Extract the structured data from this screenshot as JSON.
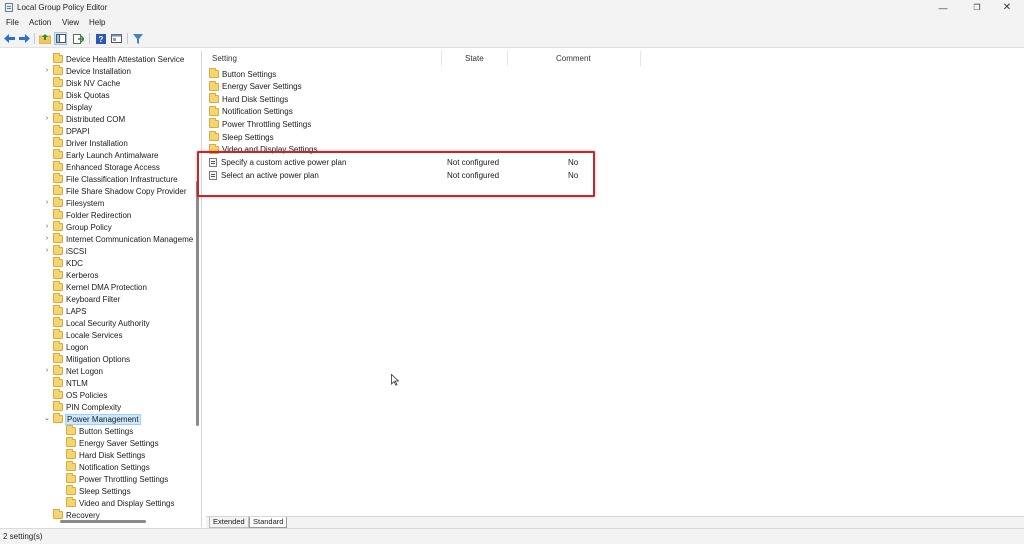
{
  "window": {
    "title": "Local Group Policy Editor",
    "min_glyph": "—",
    "max_glyph": "❐",
    "close_glyph": "✕"
  },
  "menu": {
    "file": "File",
    "action": "Action",
    "view": "View",
    "help": "Help"
  },
  "toolbar": {
    "icons": [
      "back-arrow-icon",
      "forward-arrow-icon",
      "up-folder-icon",
      "show-hide-tree-icon",
      "export-list-icon",
      "help-icon",
      "properties-icon",
      "filter-icon"
    ]
  },
  "tree": {
    "items": [
      {
        "label": "Device Health Attestation Service",
        "expandable": false
      },
      {
        "label": "Device Installation",
        "expandable": true
      },
      {
        "label": "Disk NV Cache",
        "expandable": false
      },
      {
        "label": "Disk Quotas",
        "expandable": false
      },
      {
        "label": "Display",
        "expandable": false
      },
      {
        "label": "Distributed COM",
        "expandable": true
      },
      {
        "label": "DPAPI",
        "expandable": false
      },
      {
        "label": "Driver Installation",
        "expandable": false
      },
      {
        "label": "Early Launch Antimalware",
        "expandable": false
      },
      {
        "label": "Enhanced Storage Access",
        "expandable": false
      },
      {
        "label": "File Classification Infrastructure",
        "expandable": false
      },
      {
        "label": "File Share Shadow Copy Provider",
        "expandable": false
      },
      {
        "label": "Filesystem",
        "expandable": true
      },
      {
        "label": "Folder Redirection",
        "expandable": false
      },
      {
        "label": "Group Policy",
        "expandable": true
      },
      {
        "label": "Internet Communication Manageme",
        "expandable": true
      },
      {
        "label": "iSCSI",
        "expandable": true
      },
      {
        "label": "KDC",
        "expandable": false
      },
      {
        "label": "Kerberos",
        "expandable": false
      },
      {
        "label": "Kernel DMA Protection",
        "expandable": false
      },
      {
        "label": "Keyboard Filter",
        "expandable": false
      },
      {
        "label": "LAPS",
        "expandable": false
      },
      {
        "label": "Local Security Authority",
        "expandable": false
      },
      {
        "label": "Locale Services",
        "expandable": false
      },
      {
        "label": "Logon",
        "expandable": false
      },
      {
        "label": "Mitigation Options",
        "expandable": false
      },
      {
        "label": "Net Logon",
        "expandable": true
      },
      {
        "label": "NTLM",
        "expandable": false
      },
      {
        "label": "OS Policies",
        "expandable": false
      },
      {
        "label": "PIN Complexity",
        "expandable": false
      },
      {
        "label": "Power Management",
        "expandable": true,
        "expanded": true,
        "selected": true
      },
      {
        "label": "Button Settings",
        "child": true
      },
      {
        "label": "Energy Saver Settings",
        "child": true
      },
      {
        "label": "Hard Disk Settings",
        "child": true
      },
      {
        "label": "Notification Settings",
        "child": true
      },
      {
        "label": "Power Throttling Settings",
        "child": true
      },
      {
        "label": "Sleep Settings",
        "child": true
      },
      {
        "label": "Video and Display Settings",
        "child": true
      },
      {
        "label": "Recovery",
        "expandable": false
      }
    ]
  },
  "list": {
    "columns": {
      "setting": "Setting",
      "state": "State",
      "comment": "Comment"
    },
    "folders": [
      "Button Settings",
      "Energy Saver Settings",
      "Hard Disk Settings",
      "Notification Settings",
      "Power Throttling Settings",
      "Sleep Settings",
      "Video and Display Settings"
    ],
    "settings": [
      {
        "name": "Specify a custom active power plan",
        "state": "Not configured",
        "comment": "No"
      },
      {
        "name": "Select an active power plan",
        "state": "Not configured",
        "comment": "No"
      }
    ],
    "highlight_color": "#c0282b"
  },
  "tabs": {
    "extended": "Extended",
    "standard": "Standard",
    "active": "Standard"
  },
  "status": {
    "text": "2 setting(s)"
  }
}
